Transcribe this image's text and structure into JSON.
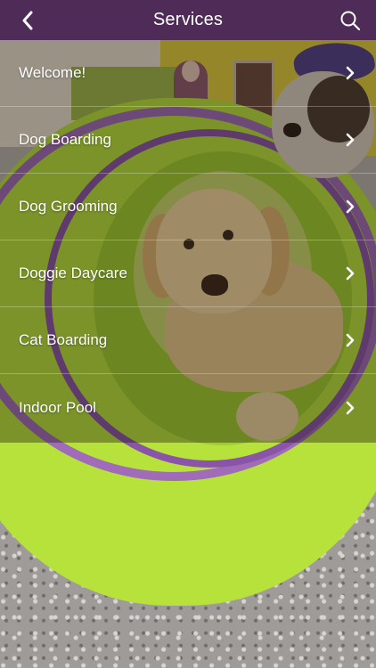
{
  "header": {
    "title": "Services",
    "back_icon": "chevron-left-icon",
    "search_icon": "search-icon",
    "background_color": "#4f2b57"
  },
  "menu": {
    "items": [
      {
        "label": "Welcome!"
      },
      {
        "label": "Dog Boarding"
      },
      {
        "label": "Dog Grooming"
      },
      {
        "label": "Doggie Daycare"
      },
      {
        "label": "Cat Boarding"
      },
      {
        "label": "Indoor Pool"
      }
    ],
    "item_icon": "chevron-right-icon"
  }
}
